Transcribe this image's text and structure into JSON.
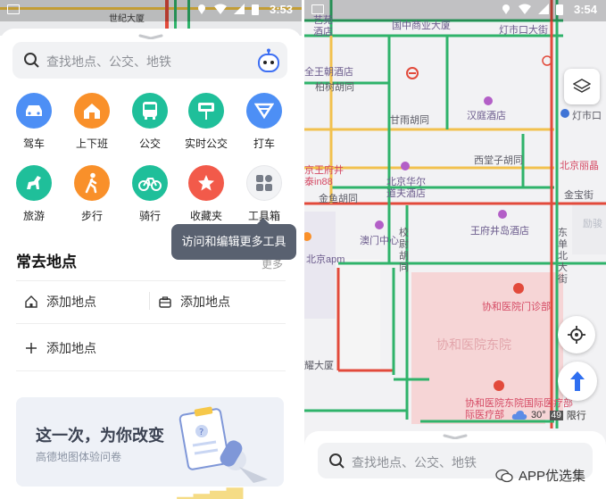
{
  "left_screen": {
    "status": {
      "time": "3:53",
      "map_label": "世纪大厦"
    },
    "search": {
      "placeholder": "查找地点、公交、地铁"
    },
    "shortcuts": [
      {
        "label": "驾车",
        "icon": "car-icon",
        "color": "#4d8ff5"
      },
      {
        "label": "上下班",
        "icon": "home-work-icon",
        "color": "#f9902a"
      },
      {
        "label": "公交",
        "icon": "bus-icon",
        "color": "#1fbf9a"
      },
      {
        "label": "实时公交",
        "icon": "bus-stop-icon",
        "color": "#1fbf9a"
      },
      {
        "label": "打车",
        "icon": "taxi-icon",
        "color": "#4d8ff5"
      },
      {
        "label": "旅游",
        "icon": "horse-icon",
        "color": "#1fbf9a"
      },
      {
        "label": "步行",
        "icon": "walk-icon",
        "color": "#f9902a"
      },
      {
        "label": "骑行",
        "icon": "bike-icon",
        "color": "#1fbf9a"
      },
      {
        "label": "收藏夹",
        "icon": "star-icon",
        "color": "#f25a4a"
      },
      {
        "label": "工具箱",
        "icon": "toolbox-icon",
        "color": "#f2f3f5"
      }
    ],
    "tooltip": "访问和编辑更多工具",
    "frequent": {
      "title": "常去地点",
      "more": "更多",
      "home": "添加地点",
      "work": "添加地点",
      "add": "添加地点"
    },
    "banner": {
      "title": "这一次，为你改变",
      "subtitle": "高德地图体验问卷"
    }
  },
  "right_screen": {
    "status": {
      "time": "3:54"
    },
    "map_labels": {
      "l1": "国中商业大厦",
      "l2": "灯市口大街",
      "l3": "艺苑",
      "l4": "酒店",
      "l5": "全王朝酒店",
      "l6": "柏树胡同",
      "l7": "甘雨胡同",
      "l8": "汉庭酒店",
      "l9": "灯市口",
      "l10": "西堂子胡同",
      "l11": "北京丽晶",
      "l12": "京王府井",
      "l13": "泰in88",
      "l14": "北京华尔",
      "l15": "道夫酒店",
      "l16": "金鱼胡同",
      "l17": "金宝街",
      "l18": "王府井岛酒店",
      "l19": "励骏",
      "l20": "澳门中心",
      "l21": "北京apm",
      "l22": "校尉胡同",
      "l23": "东单北大街",
      "l24": "协和医院门诊部",
      "l25": "协和医院东院",
      "l26": "耀大厦",
      "l27": "协和医院东院国际医疗部",
      "l28": "际医疗部"
    },
    "weather": {
      "temp": "30°",
      "aqi": "49",
      "restriction": "限行"
    },
    "search": {
      "placeholder": "查找地点、公交、地铁"
    },
    "watermark": "APP优选集"
  }
}
